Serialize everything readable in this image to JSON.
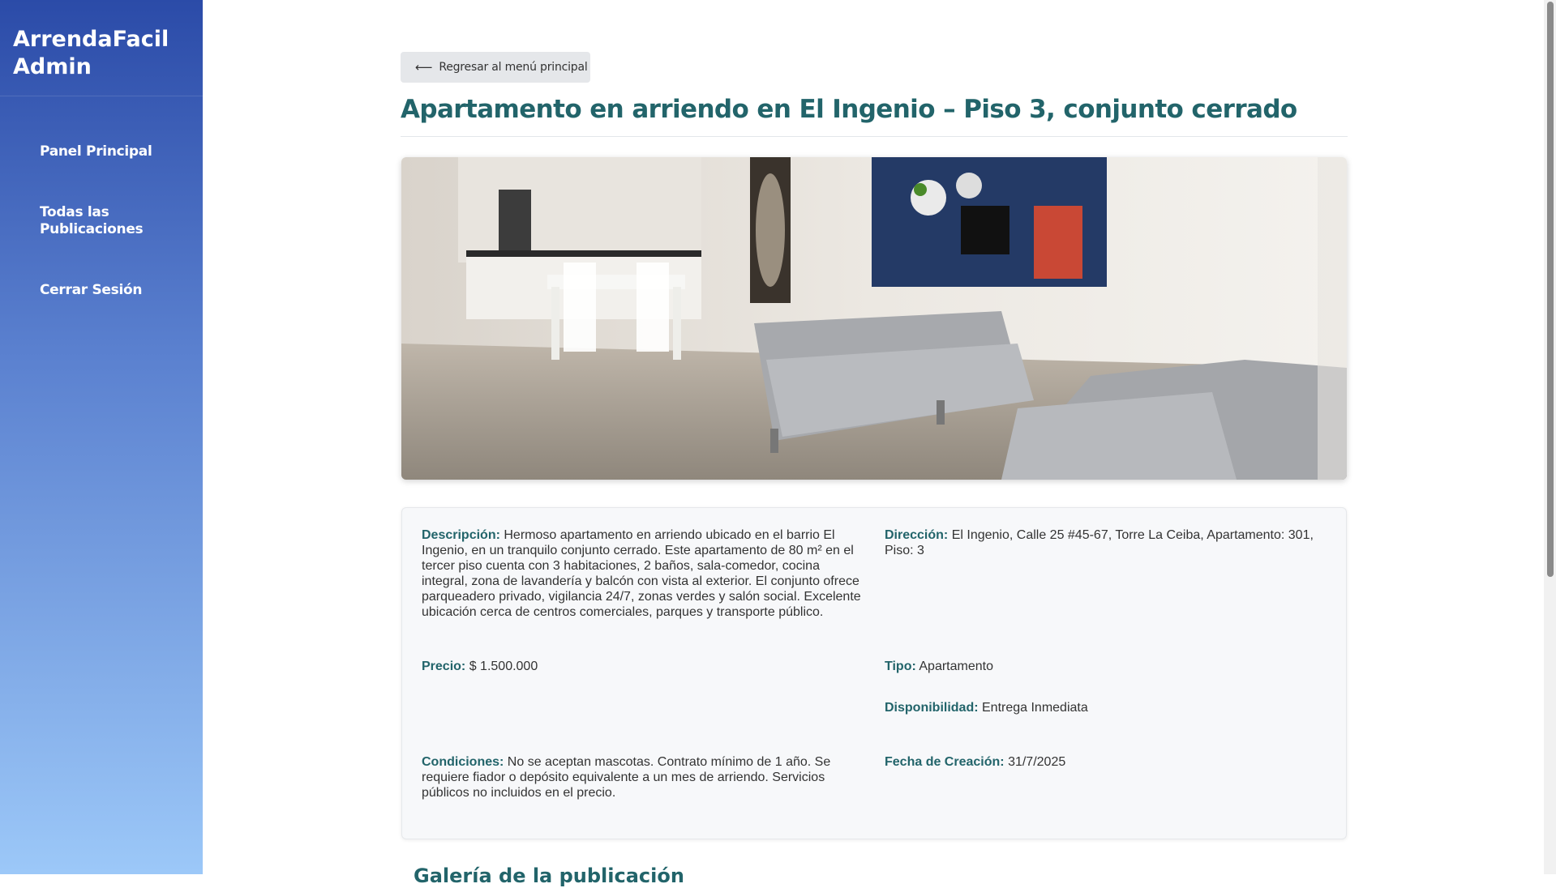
{
  "sidebar": {
    "brand_line1": "ArrendaFacil",
    "brand_line2": "Admin",
    "items": [
      {
        "label": "Panel Principal"
      },
      {
        "label": "Todas las Publicaciones"
      },
      {
        "label": "Cerrar Sesión"
      }
    ]
  },
  "main": {
    "back_label": "Regresar al menú principal",
    "back_icon": "arrow-left-icon",
    "title": "Apartamento en arriendo en El Ingenio – Piso 3, conjunto cerrado",
    "details": {
      "descripcion_label": "Descripción:",
      "descripcion": "Hermoso apartamento en arriendo ubicado en el barrio El Ingenio, en un tranquilo conjunto cerrado. Este apartamento de 80 m² en el tercer piso cuenta con 3 habitaciones, 2 baños, sala-comedor, cocina integral, zona de lavandería y balcón con vista al exterior. El conjunto ofrece parqueadero privado, vigilancia 24/7, zonas verdes y salón social. Excelente ubicación cerca de centros comerciales, parques y transporte público.",
      "direccion_label": "Dirección:",
      "direccion": "El Ingenio, Calle 25 #45-67, Torre La Ceiba, Apartamento: 301, Piso: 3",
      "precio_label": "Precio:",
      "precio": "$ 1.500.000",
      "tipo_label": "Tipo:",
      "tipo": "Apartamento",
      "disponibilidad_label": "Disponibilidad:",
      "disponibilidad": "Entrega Inmediata",
      "condiciones_label": "Condiciones:",
      "condiciones": "No se aceptan mascotas. Contrato mínimo de 1 año. Se requiere fiador o depósito equivalente a un mes de arriendo. Servicios públicos no incluidos en el precio.",
      "fecha_label": "Fecha de Creación:",
      "fecha": "31/7/2025"
    },
    "gallery_title": "Galería de la publicación"
  },
  "colors": {
    "accent": "#22646a",
    "sidebar_top": "#2b4ba8",
    "sidebar_bottom": "#9cc8f8"
  }
}
